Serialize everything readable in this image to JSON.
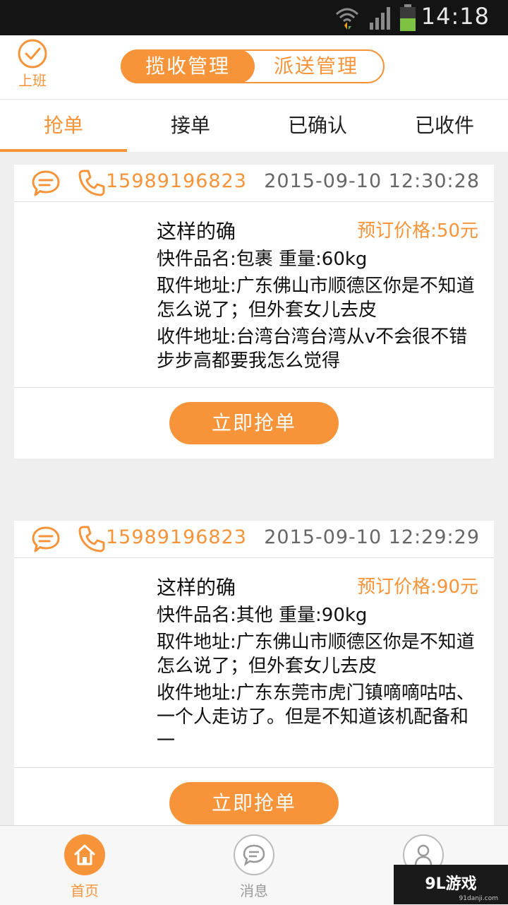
{
  "status_bar": {
    "time": "14:18",
    "icons": [
      "wifi-icon",
      "signal-icon",
      "battery-icon"
    ]
  },
  "header": {
    "duty_label": "上班",
    "segments": [
      {
        "label": "揽收管理",
        "active": true
      },
      {
        "label": "派送管理",
        "active": false
      }
    ]
  },
  "tabs": [
    {
      "label": "抢单",
      "active": true
    },
    {
      "label": "接单",
      "active": false
    },
    {
      "label": "已确认",
      "active": false
    },
    {
      "label": "已收件",
      "active": false
    }
  ],
  "orders": [
    {
      "phone": "15989196823",
      "datetime": "2015-09-10 12:30:28",
      "title": "这样的确",
      "price": "预订价格:50元",
      "item": "快件品名:包裹 重量:60kg",
      "pickup": "取件地址:广东佛山市顺德区你是不知道怎么说了；但外套女儿去皮",
      "delivery": "收件地址:台湾台湾台湾从v不会很不错步步高都要我怎么觉得",
      "action": "立即抢单"
    },
    {
      "phone": "15989196823",
      "datetime": "2015-09-10 12:29:29",
      "title": "这样的确",
      "price": "预订价格:90元",
      "item": "快件品名:其他 重量:90kg",
      "pickup": "取件地址:广东佛山市顺德区你是不知道怎么说了；但外套女儿去皮",
      "delivery": "收件地址:广东东莞市虎门镇嘀嘀咕咕、一个人走访了。但是不知道该机配备和一",
      "action": "立即抢单"
    }
  ],
  "bottom_nav": [
    {
      "label": "首页",
      "icon": "home-icon",
      "active": true
    },
    {
      "label": "消息",
      "icon": "message-icon",
      "active": false
    },
    {
      "label": "",
      "icon": "user-icon",
      "active": false
    }
  ],
  "watermark": {
    "text": "9L游戏",
    "sub": "91danji.com"
  },
  "colors": {
    "accent": "#f7943a",
    "background": "#efefef"
  }
}
